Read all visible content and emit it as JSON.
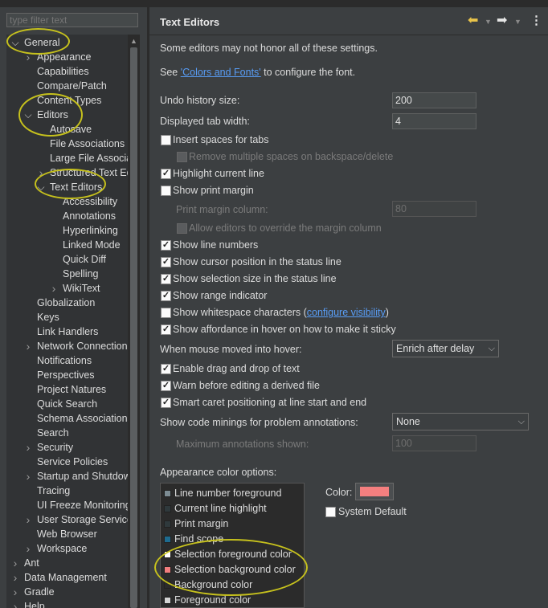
{
  "filter": {
    "placeholder": "type filter text"
  },
  "tree": [
    {
      "label": "General",
      "indent": 0,
      "expand": "open"
    },
    {
      "label": "Appearance",
      "indent": 1,
      "expand": "closed"
    },
    {
      "label": "Capabilities",
      "indent": 1,
      "expand": "none"
    },
    {
      "label": "Compare/Patch",
      "indent": 1,
      "expand": "none"
    },
    {
      "label": "Content Types",
      "indent": 1,
      "expand": "none"
    },
    {
      "label": "Editors",
      "indent": 1,
      "expand": "open"
    },
    {
      "label": "Autosave",
      "indent": 2,
      "expand": "none"
    },
    {
      "label": "File Associations",
      "indent": 2,
      "expand": "none"
    },
    {
      "label": "Large File Associa",
      "indent": 2,
      "expand": "none"
    },
    {
      "label": "Structured Text Ed",
      "indent": 2,
      "expand": "closed"
    },
    {
      "label": "Text Editors",
      "indent": 2,
      "expand": "open",
      "selected": true
    },
    {
      "label": "Accessibility",
      "indent": 3,
      "expand": "none"
    },
    {
      "label": "Annotations",
      "indent": 3,
      "expand": "none"
    },
    {
      "label": "Hyperlinking",
      "indent": 3,
      "expand": "none"
    },
    {
      "label": "Linked Mode",
      "indent": 3,
      "expand": "none"
    },
    {
      "label": "Quick Diff",
      "indent": 3,
      "expand": "none"
    },
    {
      "label": "Spelling",
      "indent": 3,
      "expand": "none"
    },
    {
      "label": "WikiText",
      "indent": 3,
      "expand": "closed"
    },
    {
      "label": "Globalization",
      "indent": 1,
      "expand": "none"
    },
    {
      "label": "Keys",
      "indent": 1,
      "expand": "none"
    },
    {
      "label": "Link Handlers",
      "indent": 1,
      "expand": "none"
    },
    {
      "label": "Network Connection",
      "indent": 1,
      "expand": "closed"
    },
    {
      "label": "Notifications",
      "indent": 1,
      "expand": "none"
    },
    {
      "label": "Perspectives",
      "indent": 1,
      "expand": "none"
    },
    {
      "label": "Project Natures",
      "indent": 1,
      "expand": "none"
    },
    {
      "label": "Quick Search",
      "indent": 1,
      "expand": "none"
    },
    {
      "label": "Schema Associations",
      "indent": 1,
      "expand": "none"
    },
    {
      "label": "Search",
      "indent": 1,
      "expand": "none"
    },
    {
      "label": "Security",
      "indent": 1,
      "expand": "closed"
    },
    {
      "label": "Service Policies",
      "indent": 1,
      "expand": "none"
    },
    {
      "label": "Startup and Shutdow",
      "indent": 1,
      "expand": "closed"
    },
    {
      "label": "Tracing",
      "indent": 1,
      "expand": "none"
    },
    {
      "label": "UI Freeze Monitoring",
      "indent": 1,
      "expand": "none"
    },
    {
      "label": "User Storage Service",
      "indent": 1,
      "expand": "closed"
    },
    {
      "label": "Web Browser",
      "indent": 1,
      "expand": "none"
    },
    {
      "label": "Workspace",
      "indent": 1,
      "expand": "closed"
    },
    {
      "label": "Ant",
      "indent": 0,
      "expand": "closed"
    },
    {
      "label": "Data Management",
      "indent": 0,
      "expand": "closed"
    },
    {
      "label": "Gradle",
      "indent": 0,
      "expand": "closed"
    },
    {
      "label": "Help",
      "indent": 0,
      "expand": "closed"
    }
  ],
  "page": {
    "title": "Text Editors",
    "note": "Some editors may not honor all of these settings.",
    "see_prefix": "See ",
    "see_link": "'Colors and Fonts'",
    "see_suffix": " to configure the font.",
    "undo_label": "Undo history size:",
    "undo_value": "200",
    "tab_label": "Displayed tab width:",
    "tab_value": "4",
    "insert_spaces": "Insert spaces for tabs",
    "remove_spaces": "Remove multiple spaces on backspace/delete",
    "highlight_line": "Highlight current line",
    "show_margin": "Show print margin",
    "margin_col_label": "Print margin column:",
    "margin_col_value": "80",
    "allow_override": "Allow editors to override the margin column",
    "line_numbers": "Show line numbers",
    "cursor_pos": "Show cursor position in the status line",
    "selection_size": "Show selection size in the status line",
    "range_indicator": "Show range indicator",
    "whitespace_prefix": "Show whitespace characters (",
    "whitespace_link": "configure visibility",
    "whitespace_suffix": ")",
    "affordance": "Show affordance in hover on how to make it sticky",
    "hover_label": "When mouse moved into hover:",
    "hover_value": "Enrich after delay",
    "drag_drop": "Enable drag and drop of text",
    "warn_derived": "Warn before editing a derived file",
    "smart_caret": "Smart caret positioning at line start and end",
    "minings_label": "Show code minings for problem annotations:",
    "minings_value": "None",
    "max_annot_label": "Maximum annotations shown:",
    "max_annot_value": "100",
    "appearance_label": "Appearance color options:",
    "color_label": "Color:",
    "system_default": "System Default"
  },
  "checks": {
    "insert_spaces": false,
    "remove_spaces": false,
    "highlight_line": true,
    "show_margin": false,
    "allow_override": false,
    "line_numbers": true,
    "cursor_pos": true,
    "selection_size": true,
    "range_indicator": true,
    "whitespace": false,
    "affordance": true,
    "drag_drop": true,
    "warn_derived": true,
    "smart_caret": true,
    "system_default": false
  },
  "color_options": [
    {
      "label": "Line number foreground",
      "color": "#7d8c93"
    },
    {
      "label": "Current line highlight",
      "color": "#2f393c"
    },
    {
      "label": "Print margin",
      "color": "#2f393c"
    },
    {
      "label": "Find scope",
      "color": "#1e6b8f"
    },
    {
      "label": "Selection foreground color",
      "color": "#ffffff"
    },
    {
      "label": "Selection background color",
      "color": "#f27d7d"
    },
    {
      "label": "Background color",
      "color": "#2b2b2b"
    },
    {
      "label": "Foreground color",
      "color": "#d4d4d4"
    }
  ],
  "colors": {
    "selected_color": "#f47f7f",
    "annotation": "#c6c11d",
    "link": "#589df6"
  },
  "icons": {
    "back": "back-arrow-icon",
    "forward": "forward-arrow-icon",
    "menu": "view-menu-icon"
  }
}
